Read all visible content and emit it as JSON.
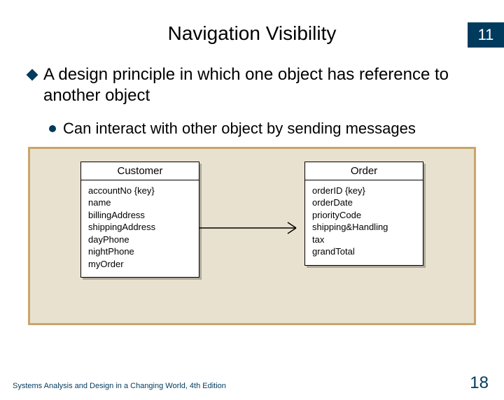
{
  "chapter_number": "11",
  "title": "Navigation Visibility",
  "bullet_main": "A design principle in which one object has reference to another object",
  "bullet_sub": "Can interact with other object by sending messages",
  "diagram": {
    "left": {
      "name": "Customer",
      "attrs": [
        "accountNo {key}",
        "name",
        "billingAddress",
        "shippingAddress",
        "dayPhone",
        "nightPhone",
        "myOrder"
      ]
    },
    "right": {
      "name": "Order",
      "attrs": [
        "orderID {key}",
        "orderDate",
        "priorityCode",
        "shipping&Handling",
        "tax",
        "grandTotal"
      ]
    }
  },
  "footer": "Systems Analysis and Design in a Changing World, 4th Edition",
  "page_number": "18"
}
